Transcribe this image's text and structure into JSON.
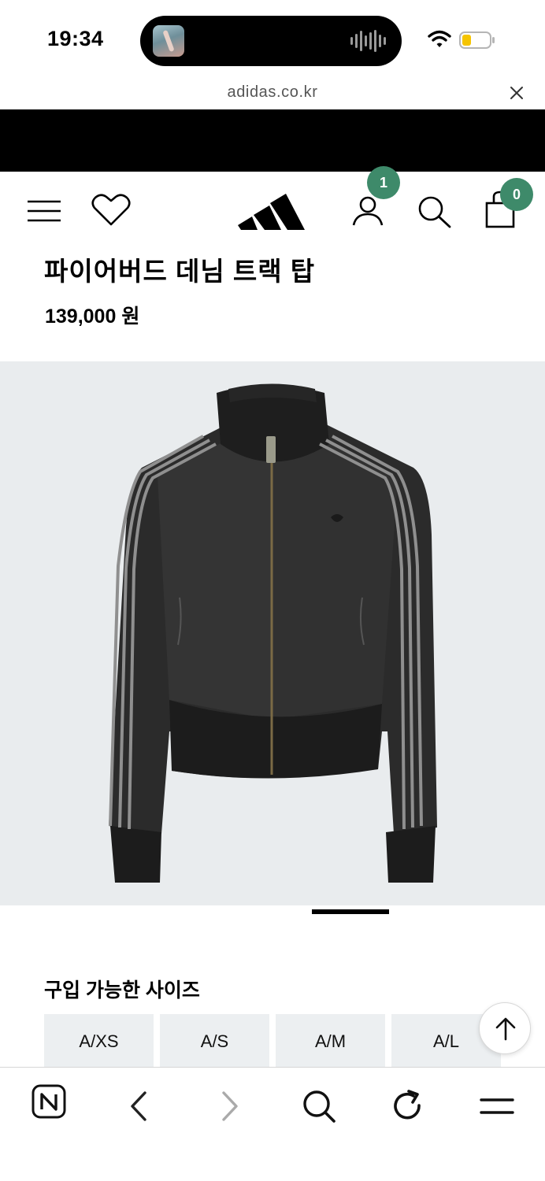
{
  "status_bar": {
    "time": "19:34",
    "icons": [
      "now-playing-art-icon",
      "audio-waveform-icon",
      "wifi-icon",
      "battery-low-icon"
    ]
  },
  "browser": {
    "url": "adidas.co.kr",
    "close_icon": "close-icon"
  },
  "header": {
    "icons": [
      "menu-icon",
      "wishlist-heart-icon",
      "adidas-logo",
      "account-icon",
      "search-icon",
      "cart-bag-icon"
    ],
    "account_badge": "1",
    "cart_badge": "0",
    "badge_color": "#3e8a6a"
  },
  "product": {
    "title": "파이어버드 데님 트랙 탑",
    "price": "139,000 원",
    "image_bg": "#e9ecee"
  },
  "sizes": {
    "heading": "구입 가능한 사이즈",
    "options": [
      "A/XS",
      "A/S",
      "A/M",
      "A/L"
    ]
  },
  "toolbar": {
    "icons": [
      "naver-n-icon",
      "back-icon",
      "forward-icon",
      "search-icon",
      "reload-icon",
      "menu-icon"
    ]
  }
}
